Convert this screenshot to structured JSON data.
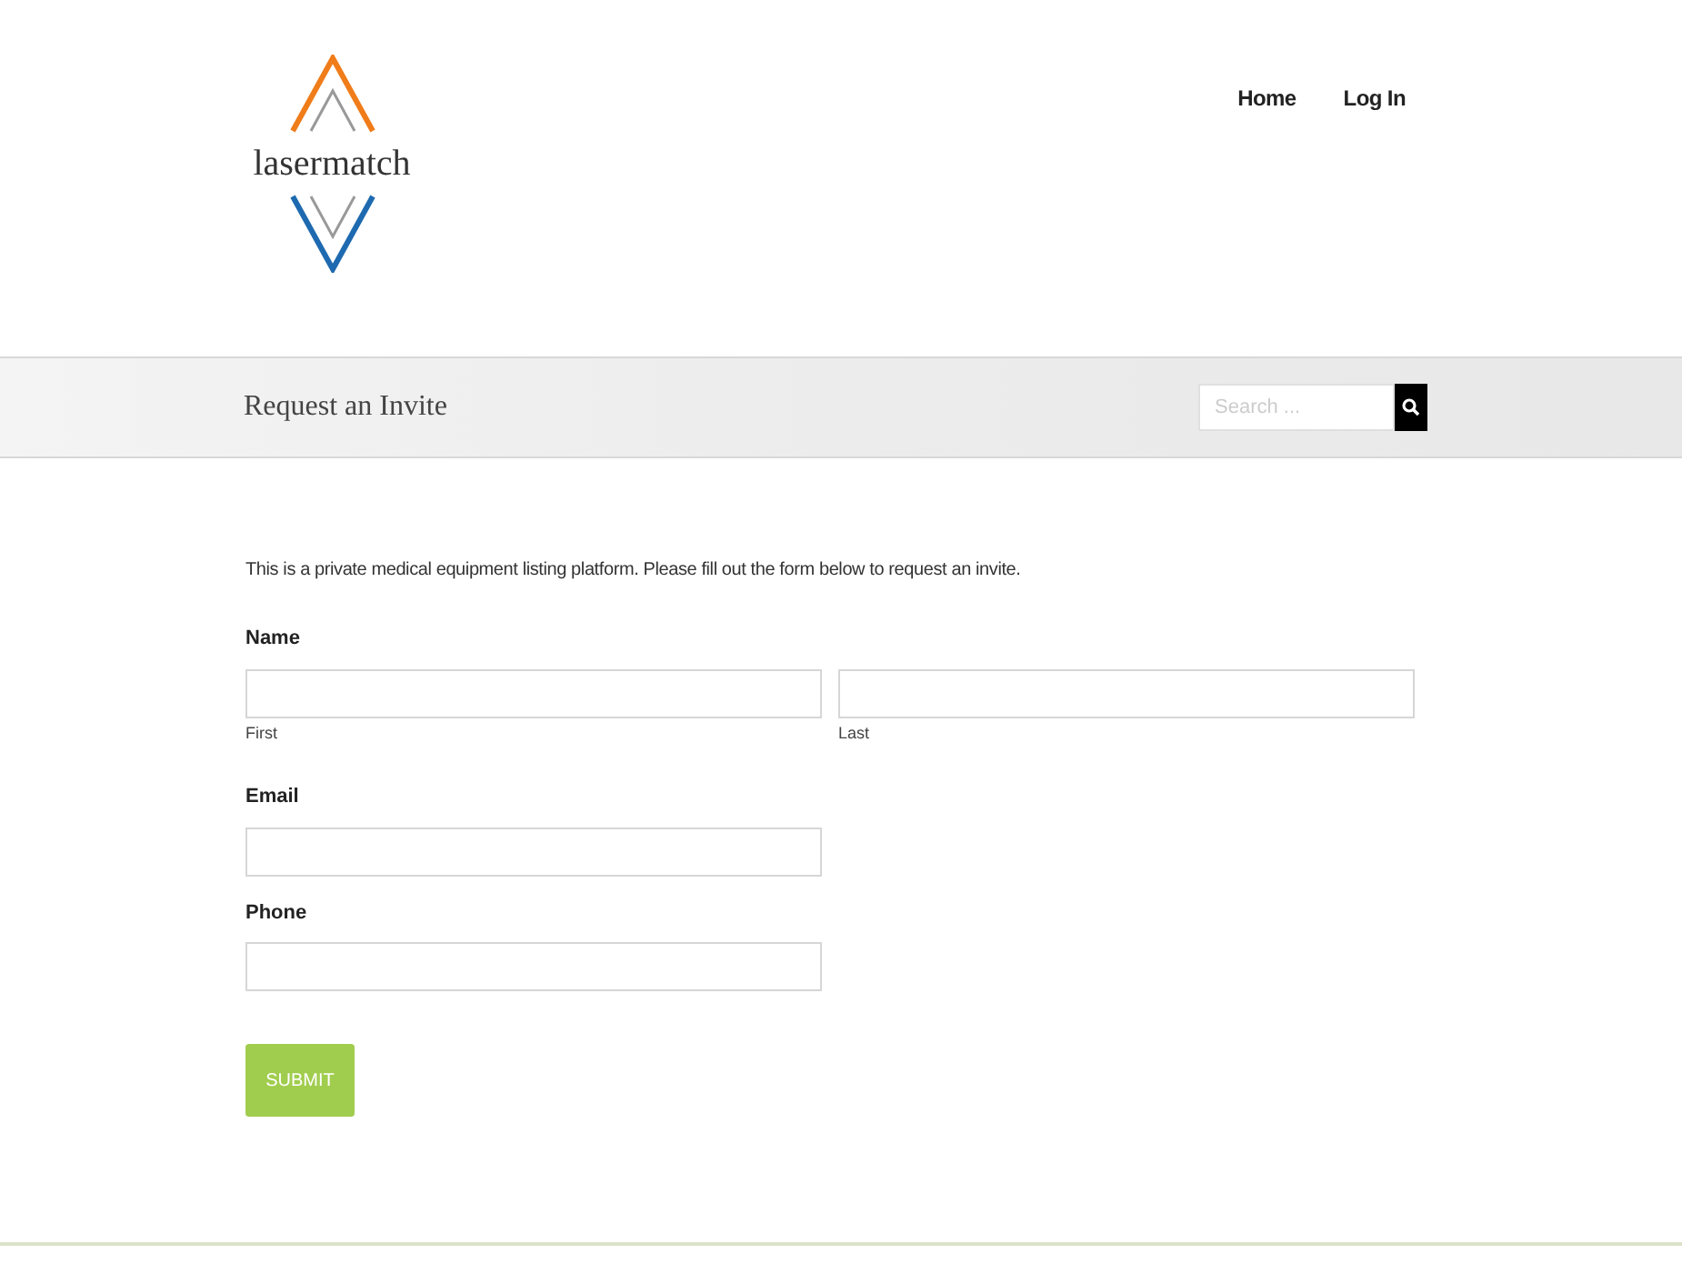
{
  "logo": {
    "text": "lasermatch"
  },
  "nav": [
    {
      "label": "Home"
    },
    {
      "label": "Log In"
    }
  ],
  "page_title": "Request an Invite",
  "search": {
    "placeholder": "Search ..."
  },
  "intro": "This is a private medical equipment listing platform. Please fill out the form below to request an invite.",
  "form": {
    "fields": [
      {
        "label": "Name",
        "kind": "split",
        "parts": [
          {
            "sublabel": "First"
          },
          {
            "sublabel": "Last"
          }
        ]
      },
      {
        "label": "Email",
        "kind": "single"
      },
      {
        "label": "Phone",
        "kind": "single"
      }
    ],
    "submit": "SUBMIT"
  }
}
